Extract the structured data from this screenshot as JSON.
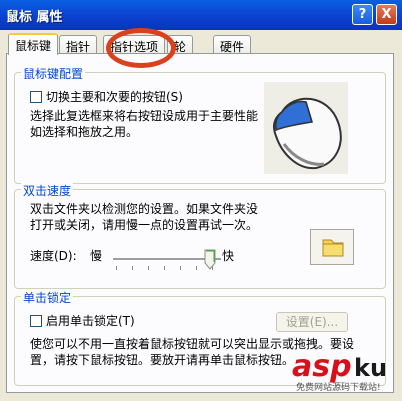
{
  "window": {
    "title": "鼠标 属性",
    "help_label": "?",
    "close_label": "X"
  },
  "tabs": [
    {
      "label": "鼠标键",
      "active": true
    },
    {
      "label": "指针",
      "active": false
    },
    {
      "label": "指针选项",
      "active": false
    },
    {
      "label": "轮",
      "active": false
    },
    {
      "label": "硬件",
      "active": false
    }
  ],
  "button_config": {
    "title": "鼠标键配置",
    "switch_checkbox": "切换主要和次要的按钮(S)",
    "switch_checked": false,
    "desc1": "选择此复选框来将右按钮设成用于主要性能",
    "desc2": "如选择和拖放之用。"
  },
  "double_click": {
    "title": "双击速度",
    "desc1": "双击文件夹以检测您的设置。如果文件夹没",
    "desc2": "打开或关闭，请用慢一点的设置再试一次。",
    "speed_label": "速度(D):",
    "slow": "慢",
    "fast": "快",
    "speed_level": 0.9
  },
  "click_lock": {
    "title": "单击锁定",
    "checkbox": "启用单击锁定(T)",
    "checked": false,
    "settings_button": "设置(E)...",
    "desc1": "使您可以不用一直按着鼠标按钮就可以突出显示或拖拽。要设",
    "desc2": "置，请按下鼠标按钮。要放开请再单击鼠标按钮。"
  },
  "watermark": {
    "brand": "aspku",
    "sub": "免费网站源码下载站!"
  },
  "colors": {
    "titlebar": "#0b3fcf",
    "group_title": "#0046d5",
    "highlight_oval": "#d9421c"
  }
}
